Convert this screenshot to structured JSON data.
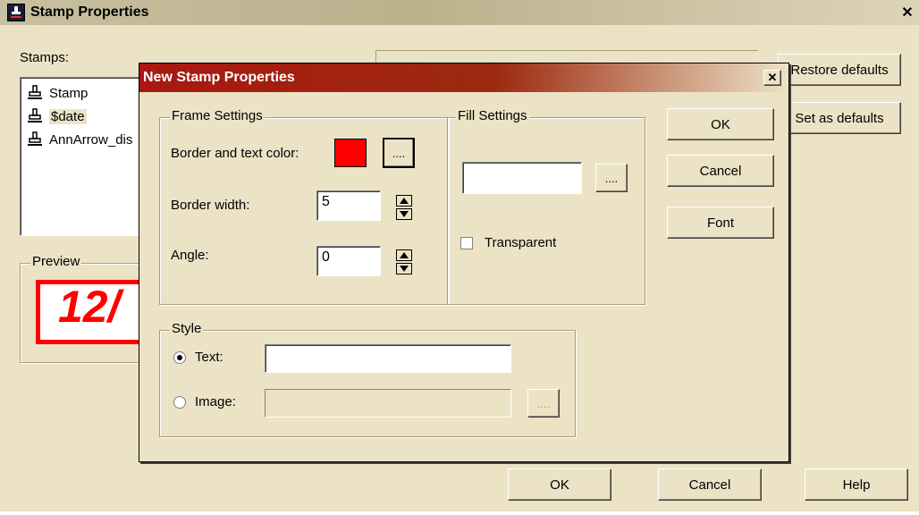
{
  "outer": {
    "title": "Stamp Properties",
    "stamps_label": "Stamps:",
    "stamps": [
      {
        "label": "Stamp"
      },
      {
        "label": "$date"
      },
      {
        "label": "AnnArrow_dis"
      }
    ],
    "preview_label": "Preview",
    "preview_text": "12/",
    "restore_defaults": "Restore defaults",
    "set_as_defaults": "Set as defaults",
    "ok": "OK",
    "cancel": "Cancel",
    "help": "Help",
    "close_glyph": "✕"
  },
  "dialog": {
    "title": "New Stamp Properties",
    "close_glyph": "✕",
    "frame": {
      "legend": "Frame Settings",
      "border_color_label": "Border and text color:",
      "border_color": "#ff0000",
      "color_button": "....",
      "border_width_label": "Border width:",
      "border_width": "5",
      "angle_label": "Angle:",
      "angle": "0"
    },
    "fill": {
      "legend": "Fill Settings",
      "color_value": "",
      "color_button": "....",
      "transparent_label": "Transparent",
      "transparent_checked": false
    },
    "style": {
      "legend": "Style",
      "text_label": "Text:",
      "text_value": "",
      "image_label": "Image:",
      "image_value": "",
      "image_button": "....",
      "selected": "text"
    },
    "ok": "OK",
    "cancel": "Cancel",
    "font": "Font"
  },
  "colors": {
    "dialog_face": "#ece2c6",
    "title_red": "#a81810",
    "preview_red": "#ff0000"
  }
}
